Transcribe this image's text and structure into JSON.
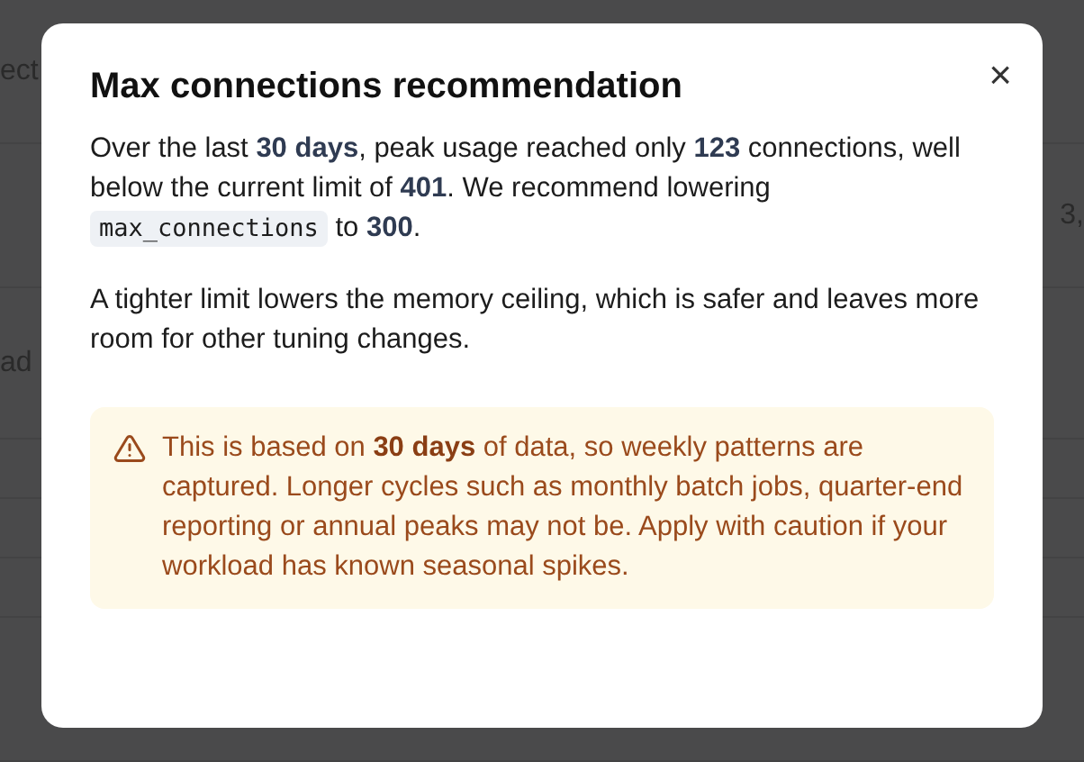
{
  "background": {
    "fragments": [
      "ect",
      "3,",
      "ad"
    ]
  },
  "dialog": {
    "title": "Max connections recommendation",
    "close": "×",
    "summary": {
      "before": "Over the last **30 days**, peak usage reached only **123** connections, well below the current limit of **401**. We recommend lowering",
      "code": "max_connections",
      "after": "to **300**."
    },
    "note": "A tighter limit lowers the memory ceiling, which is safer and leaves more room for other tuning changes.",
    "warning": {
      "kind": "caution",
      "text": "This is based on **30 days** of data, so weekly patterns are captured. Longer cycles such as monthly batch jobs, quarter-end reporting or annual peaks may not be. Apply with caution if your workload has known seasonal spikes."
    }
  }
}
